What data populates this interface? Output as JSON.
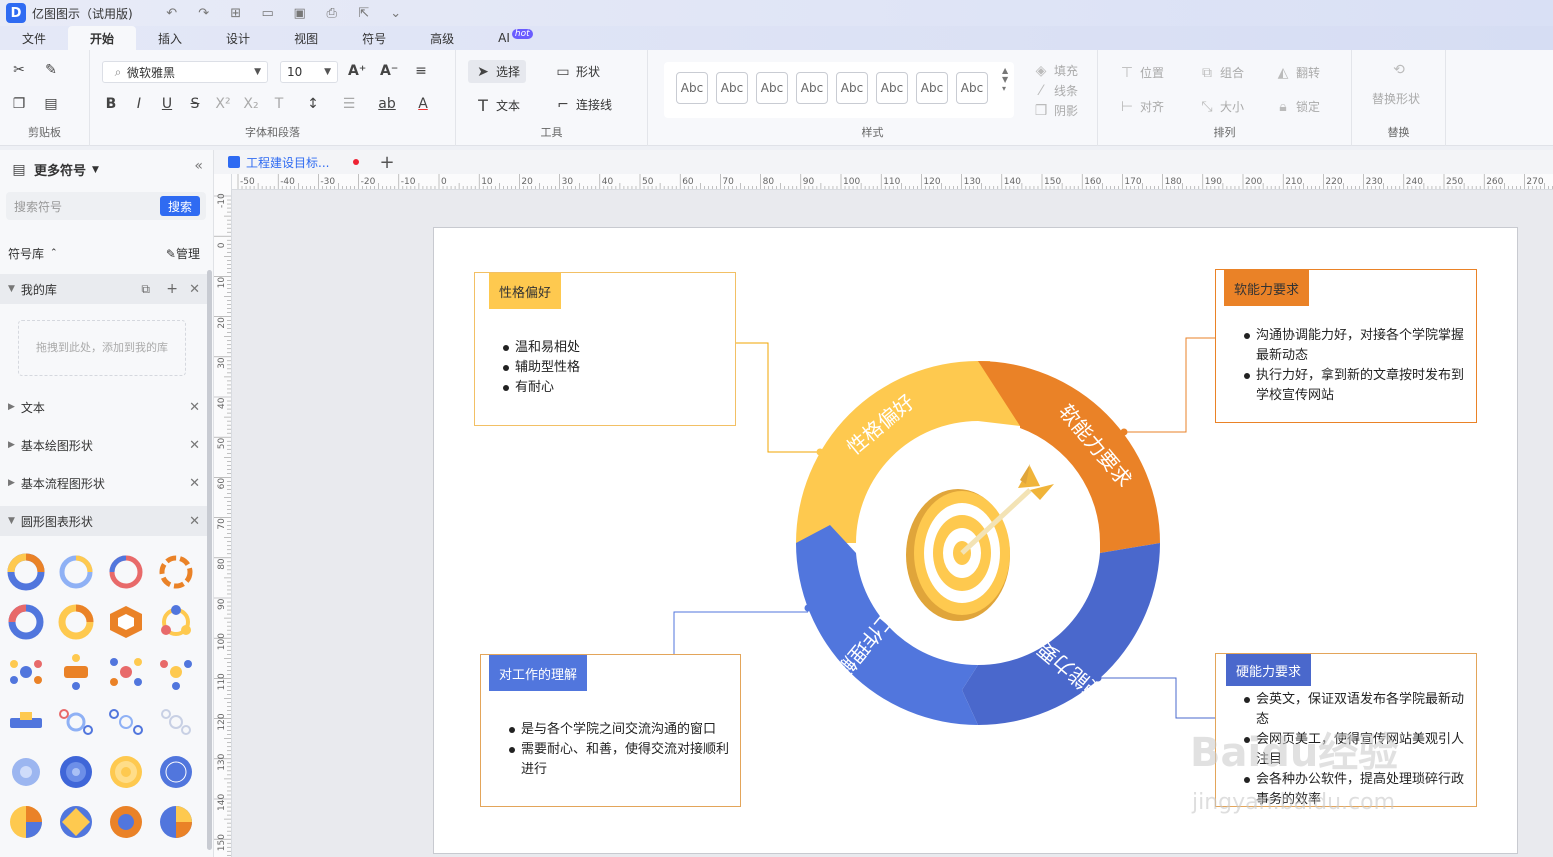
{
  "app": {
    "title": "亿图图示（试用版)"
  },
  "menu": [
    "文件",
    "开始",
    "插入",
    "设计",
    "视图",
    "符号",
    "高级",
    "AI"
  ],
  "menu_active": "开始",
  "hot_badge": "hot",
  "ribbon": {
    "font_name": "微软雅黑",
    "font_size": "10",
    "groups": {
      "clipboard": "剪贴板",
      "font": "字体和段落",
      "tools": "工具",
      "styles": "样式",
      "arrange": "排列",
      "replace": "替换"
    },
    "tools": {
      "select": "选择",
      "shape": "形状",
      "text": "文本",
      "connector": "连接线"
    },
    "style_sample": "Abc",
    "style_opts": {
      "fill": "填充",
      "line": "线条",
      "shadow": "阴影"
    },
    "arrange": {
      "position": "位置",
      "group": "组合",
      "flip": "翻转",
      "align": "对齐",
      "size": "大小",
      "lock": "锁定"
    },
    "replace_shape": "替换形状"
  },
  "doc_tab": "工程建设目标...",
  "sidebar": {
    "title": "更多符号",
    "search_placeholder": "搜索符号",
    "search_btn": "搜索",
    "library": "符号库",
    "manage": "管理",
    "my_lib": "我的库",
    "drop_hint": "拖拽到此处，添加到我的库",
    "categories": [
      "文本",
      "基本绘图形状",
      "基本流程图形状",
      "圆形图表形状"
    ]
  },
  "ruler_h": [
    "-50",
    "-40",
    "-30",
    "-20",
    "-10",
    "0",
    "10",
    "20",
    "30",
    "40",
    "50",
    "60",
    "70",
    "80",
    "90",
    "100",
    "110",
    "120",
    "130",
    "140",
    "150",
    "160",
    "170",
    "180",
    "190",
    "200",
    "210",
    "220",
    "230",
    "240",
    "250",
    "260",
    "270"
  ],
  "ruler_v": [
    "-10",
    "0",
    "10",
    "20",
    "30",
    "40",
    "50",
    "60",
    "70",
    "80",
    "90",
    "100",
    "110",
    "120",
    "130",
    "140",
    "150"
  ],
  "diagram": {
    "segments": [
      "性格偏好",
      "软能力要求",
      "硬能力要求",
      "工作理解"
    ],
    "colors": {
      "yellow": "#fec94f",
      "orange": "#ea8227",
      "blue": "#5176dd",
      "darkblue": "#4a68cc"
    },
    "boxes": {
      "personality": {
        "title": "性格偏好",
        "items": [
          "温和易相处",
          "辅助型性格",
          "有耐心"
        ]
      },
      "soft": {
        "title": "软能力要求",
        "items": [
          "沟通协调能力好，对接各个学院掌握最新动态",
          "执行力好，拿到新的文章按时发布到学校宣传网站"
        ]
      },
      "work": {
        "title": "对工作的理解",
        "items": [
          "是与各个学院之间交流沟通的窗口",
          "需要耐心、和善，使得交流对接顺利进行"
        ]
      },
      "hard": {
        "title": "硬能力要求",
        "items": [
          "会英文，保证双语发布各学院最新动态",
          "会网页美工，使得宣传网站美观引人注目",
          "会各种办公软件，提高处理琐碎行政事务的效率"
        ]
      }
    }
  },
  "watermark": {
    "main": "Baidu经验",
    "sub": "jingyan.baidu.com"
  }
}
